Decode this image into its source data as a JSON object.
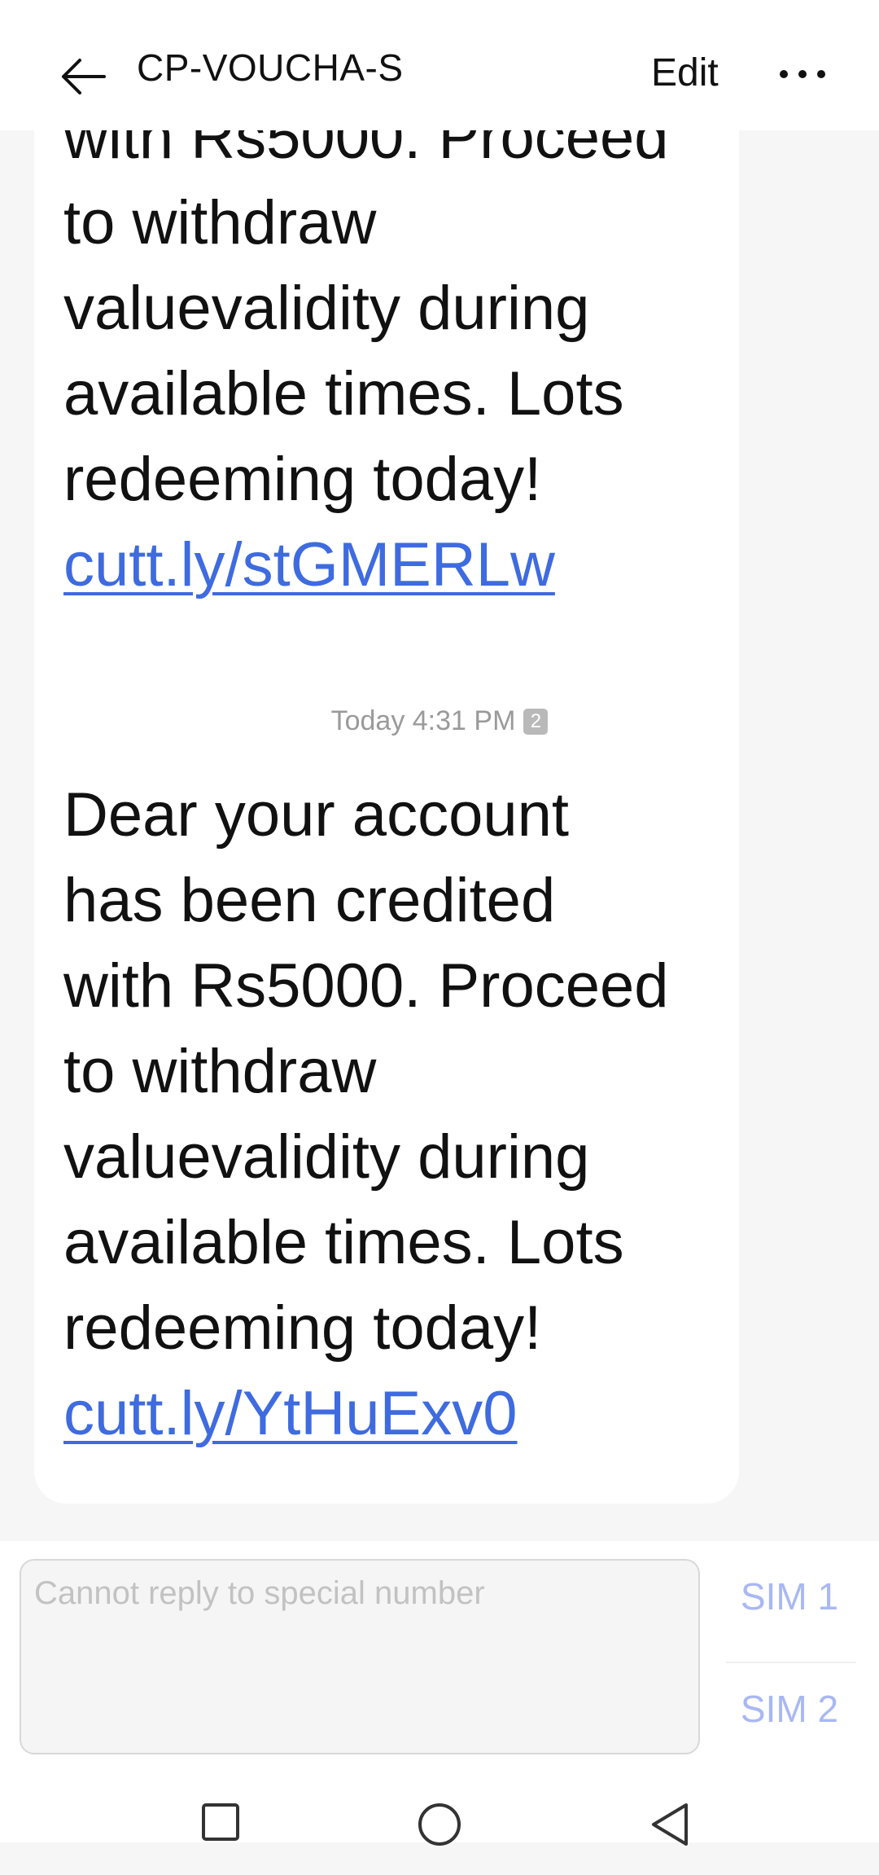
{
  "header": {
    "title": "CP-VOUCHA-S",
    "edit_label": "Edit",
    "back_icon": "arrow-left-icon",
    "more_icon": "more-dots-icon"
  },
  "messages": [
    {
      "text": "with Rs5000. Proceed\nto withdraw\nvaluevalidity during\navailable times. Lots\nredeeming today!",
      "link": "cutt.ly/stGMERLw"
    },
    {
      "text": "Dear your account\nhas been credited\nwith Rs5000. Proceed\nto withdraw\nvaluevalidity during\navailable times. Lots\nredeeming today!",
      "link": "cutt.ly/YtHuExv0"
    }
  ],
  "timestamp": {
    "text": "Today 4:31 PM",
    "sim_badge": "2"
  },
  "composer": {
    "placeholder": "Cannot reply to special number",
    "sim1_label": "SIM 1",
    "sim2_label": "SIM 2"
  },
  "navbar": {
    "recents_icon": "square-icon",
    "home_icon": "circle-icon",
    "back_icon": "triangle-back-icon"
  },
  "colors": {
    "link": "#3f6be0",
    "sim_text": "#a9b8f2",
    "background": "#f6f6f6",
    "bubble": "#ffffff"
  }
}
